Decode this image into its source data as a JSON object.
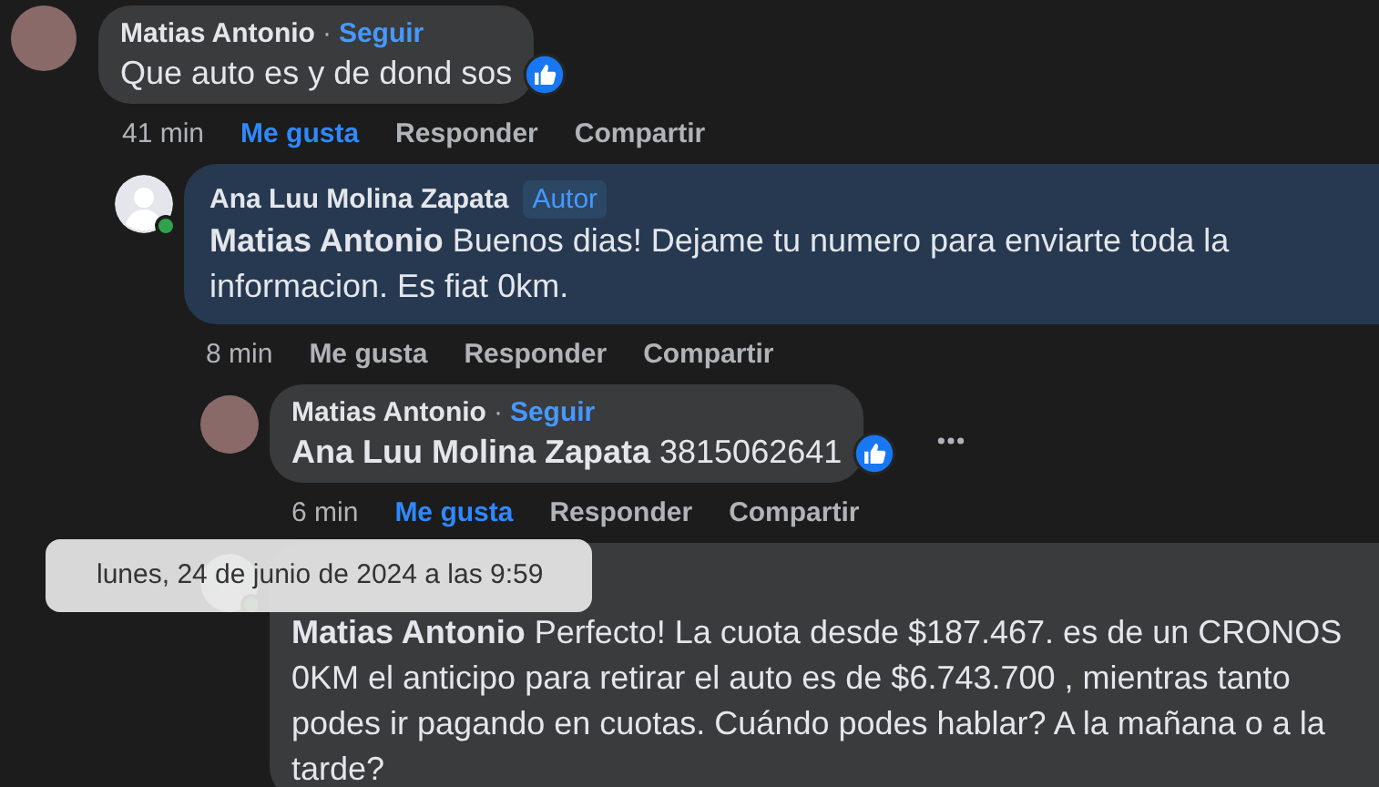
{
  "comments": [
    {
      "author": "Matias Antonio",
      "separator": "·",
      "follow": "Seguir",
      "highlight": false,
      "text": "Que auto es y de dond sos",
      "reaction": true,
      "time": "41 min",
      "actions": [
        {
          "label": "Me gusta",
          "selected": true
        },
        {
          "label": "Responder",
          "selected": false
        },
        {
          "label": "Compartir",
          "selected": false
        }
      ],
      "children": [
        {
          "author": "Ana Luu Molina Zapata",
          "badge": "Autor",
          "online": true,
          "highlight": true,
          "text": "**Matias Antonio** Buenos dias! Dejame tu numero para enviarte toda la informacion. Es fiat 0km.",
          "time": "8 min",
          "actions": [
            {
              "label": "Me gusta",
              "selected": false
            },
            {
              "label": "Responder",
              "selected": false
            },
            {
              "label": "Compartir",
              "selected": false
            }
          ],
          "children": [
            {
              "author": "Matias Antonio",
              "separator": "·",
              "follow": "Seguir",
              "highlight": false,
              "text": "**Ana Luu Molina Zapata** 3815062641",
              "reaction": true,
              "more": true,
              "time": "6 min",
              "actions": [
                {
                  "label": "Me gusta",
                  "selected": true
                },
                {
                  "label": "Responder",
                  "selected": false
                },
                {
                  "label": "Compartir",
                  "selected": false
                }
              ]
            },
            {
              "online": true,
              "highlight": false,
              "text": "**Matias Antonio** Perfecto! La cuota desde $187.467. es de un CRONOS 0KM el anticipo para retirar el auto es de $6.743.700 , mientras tanto podes ir pagando en cuotas. Cuándo podes hablar? A la mañana o a la tarde?"
            }
          ]
        }
      ]
    }
  ],
  "tooltip": "lunes, 24 de junio de 2024 a las 9:59"
}
